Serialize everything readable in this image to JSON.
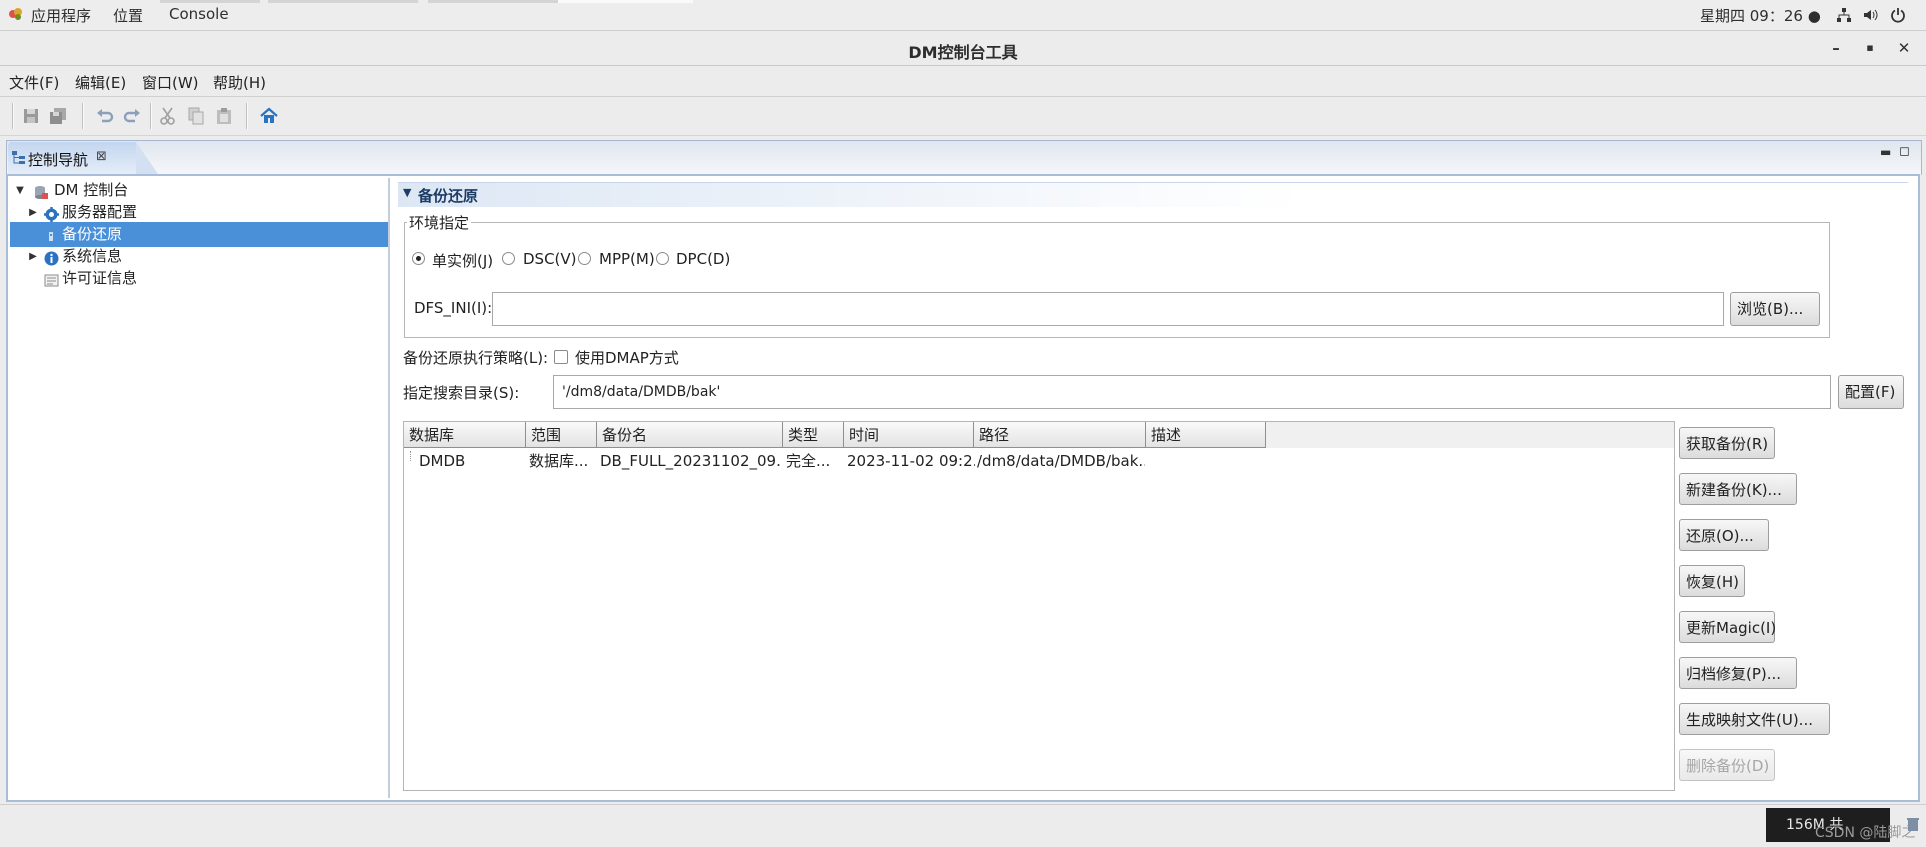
{
  "topbar": {
    "apps_label": "应用程序",
    "places_label": "位置",
    "console_label": "Console",
    "clock": "星期四 09：26 ●"
  },
  "window": {
    "title": "DM控制台工具"
  },
  "menubar": {
    "items": [
      "文件(F)",
      "编辑(E)",
      "窗口(W)",
      "帮助(H)"
    ]
  },
  "view": {
    "tab_label": "控制导航"
  },
  "tree": {
    "items": [
      {
        "label": "DM 控制台"
      },
      {
        "label": "服务器配置"
      },
      {
        "label": "备份还原"
      },
      {
        "label": "系统信息"
      },
      {
        "label": "许可证信息"
      }
    ]
  },
  "section": {
    "title": "备份还原"
  },
  "env": {
    "legend": "环境指定",
    "options": [
      "单实例(J)",
      "DSC(V)",
      "MPP(M)",
      "DPC(D)"
    ],
    "selected": "单实例(J)",
    "dfs_label": "DFS_INI(I):",
    "dfs_value": "",
    "browse_button": "浏览(B)..."
  },
  "strategy": {
    "label": "备份还原执行策略(L):",
    "checkbox_label": "使用DMAP方式",
    "checked": false
  },
  "search_dir": {
    "label": "指定搜索目录(S):",
    "value": "'/dm8/data/DMDB/bak'",
    "config_button": "配置(F)"
  },
  "table": {
    "columns": [
      "数据库",
      "范围",
      "备份名",
      "类型",
      "时间",
      "路径",
      "描述"
    ],
    "rows": [
      [
        "DMDB",
        "数据库...",
        "DB_FULL_20231102_09...",
        "完全...",
        "2023-11-02  09:2...",
        "/dm8/data/DMDB/bak...",
        ""
      ]
    ]
  },
  "actions": {
    "buttons": [
      {
        "label": "获取备份(R)",
        "enabled": true
      },
      {
        "label": "新建备份(K)...",
        "enabled": true
      },
      {
        "label": "还原(O)...",
        "enabled": true
      },
      {
        "label": "恢复(H)",
        "enabled": true
      },
      {
        "label": "更新Magic(I)",
        "enabled": true
      },
      {
        "label": "归档修复(P)...",
        "enabled": true
      },
      {
        "label": "生成映射文件(U)...",
        "enabled": true
      },
      {
        "label": "删除备份(D)",
        "enabled": false
      }
    ]
  },
  "status": {
    "heap": "156M 共",
    "watermark": "CSDN @陆脚之"
  }
}
